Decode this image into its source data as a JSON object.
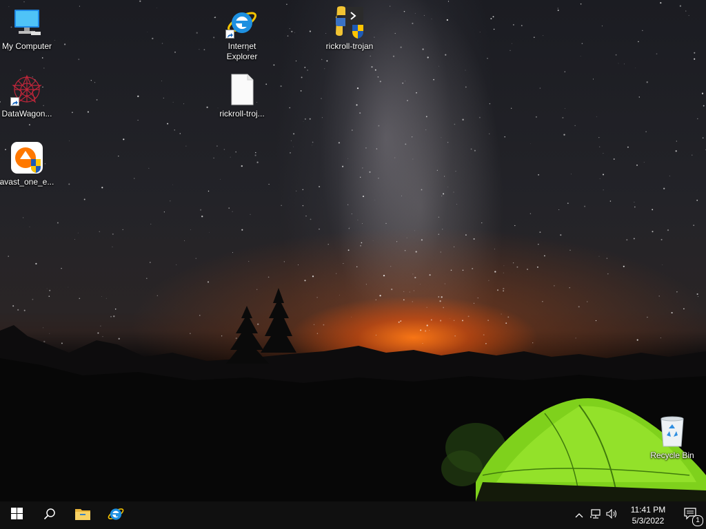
{
  "desktop": {
    "icons": [
      {
        "label": "My Computer",
        "icon": "computer-icon"
      },
      {
        "label": "DataWagon...",
        "icon": "datawagon-icon",
        "shortcut": true
      },
      {
        "label": "avast_one_e...",
        "icon": "avast-icon"
      },
      {
        "label": "Internet\nExplorer",
        "icon": "internet-explorer-icon",
        "shortcut": true
      },
      {
        "label": "rickroll-troj...",
        "icon": "blank-file-icon"
      },
      {
        "label": "rickroll-trojan",
        "icon": "python-installer-icon"
      },
      {
        "label": "Recycle Bin",
        "icon": "recycle-bin-icon"
      }
    ]
  },
  "taskbar": {
    "start": "windows-logo-icon",
    "search": "search-icon",
    "pinned": [
      {
        "name": "File Explorer",
        "icon": "folder-icon"
      },
      {
        "name": "Internet Explorer",
        "icon": "internet-explorer-icon"
      }
    ],
    "tray": {
      "icons": [
        "chevron-up-icon",
        "network-icon",
        "volume-icon"
      ],
      "time": "11:41 PM",
      "date": "5/3/2022",
      "notification_count": "1"
    }
  },
  "colors": {
    "taskbar_bg": "#101010",
    "sunset_glow": "#ff7a14",
    "tent_green": "#8fe020",
    "accent": "#76b9ed"
  }
}
